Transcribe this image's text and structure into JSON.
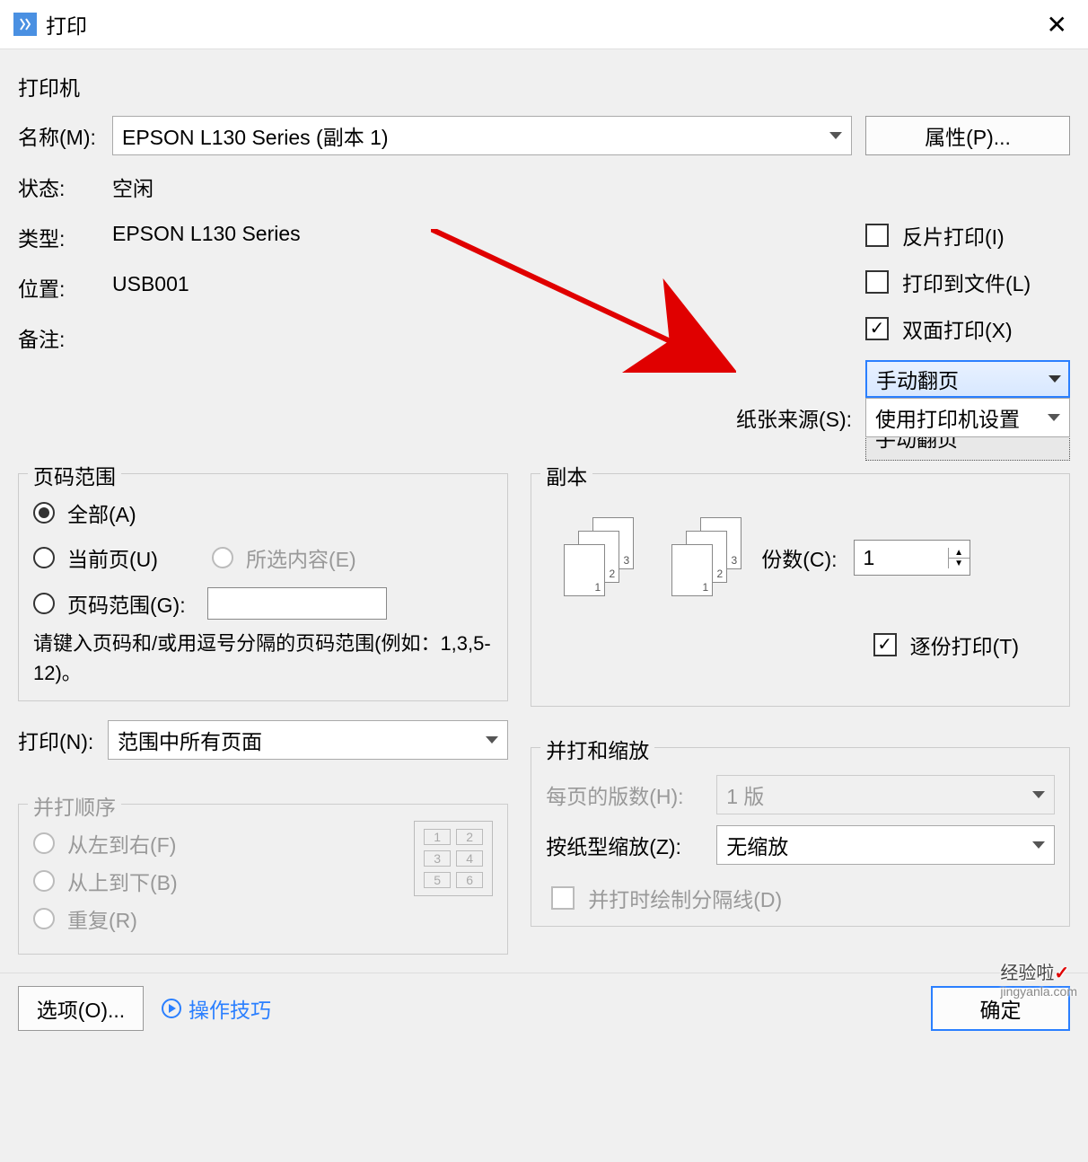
{
  "title": "打印",
  "printer": {
    "section": "打印机",
    "name_label": "名称(M):",
    "name_value": "EPSON L130 Series (副本 1)",
    "properties_btn": "属性(P)...",
    "status_label": "状态:",
    "status_value": "空闲",
    "type_label": "类型:",
    "type_value": "EPSON L130 Series",
    "location_label": "位置:",
    "location_value": "USB001",
    "comment_label": "备注:",
    "mirror_label": "反片打印(I)",
    "tofile_label": "打印到文件(L)",
    "duplex_label": "双面打印(X)",
    "duplex_mode": "手动翻页",
    "duplex_option": "手动翻页"
  },
  "paper_source": {
    "label": "纸张来源(S):",
    "value": "使用打印机设置"
  },
  "range": {
    "section": "页码范围",
    "all": "全部(A)",
    "current": "当前页(U)",
    "selection": "所选内容(E)",
    "pages": "页码范围(G):",
    "hint": "请键入页码和/或用逗号分隔的页码范围(例如：1,3,5-12)。"
  },
  "print_what": {
    "label": "打印(N):",
    "value": "范围中所有页面"
  },
  "order": {
    "section": "并打顺序",
    "lr": "从左到右(F)",
    "tb": "从上到下(B)",
    "repeat": "重复(R)"
  },
  "copies": {
    "section": "副本",
    "count_label": "份数(C):",
    "count_value": "1",
    "collate": "逐份打印(T)"
  },
  "zoom": {
    "section": "并打和缩放",
    "perpage_label": "每页的版数(H):",
    "perpage_value": "1 版",
    "scale_label": "按纸型缩放(Z):",
    "scale_value": "无缩放",
    "border": "并打时绘制分隔线(D)"
  },
  "bottom": {
    "options": "选项(O)...",
    "tips": "操作技巧",
    "ok": "确定"
  },
  "watermark": {
    "main": "经验啦",
    "check": "✓",
    "sub": "jingyanla.com"
  }
}
